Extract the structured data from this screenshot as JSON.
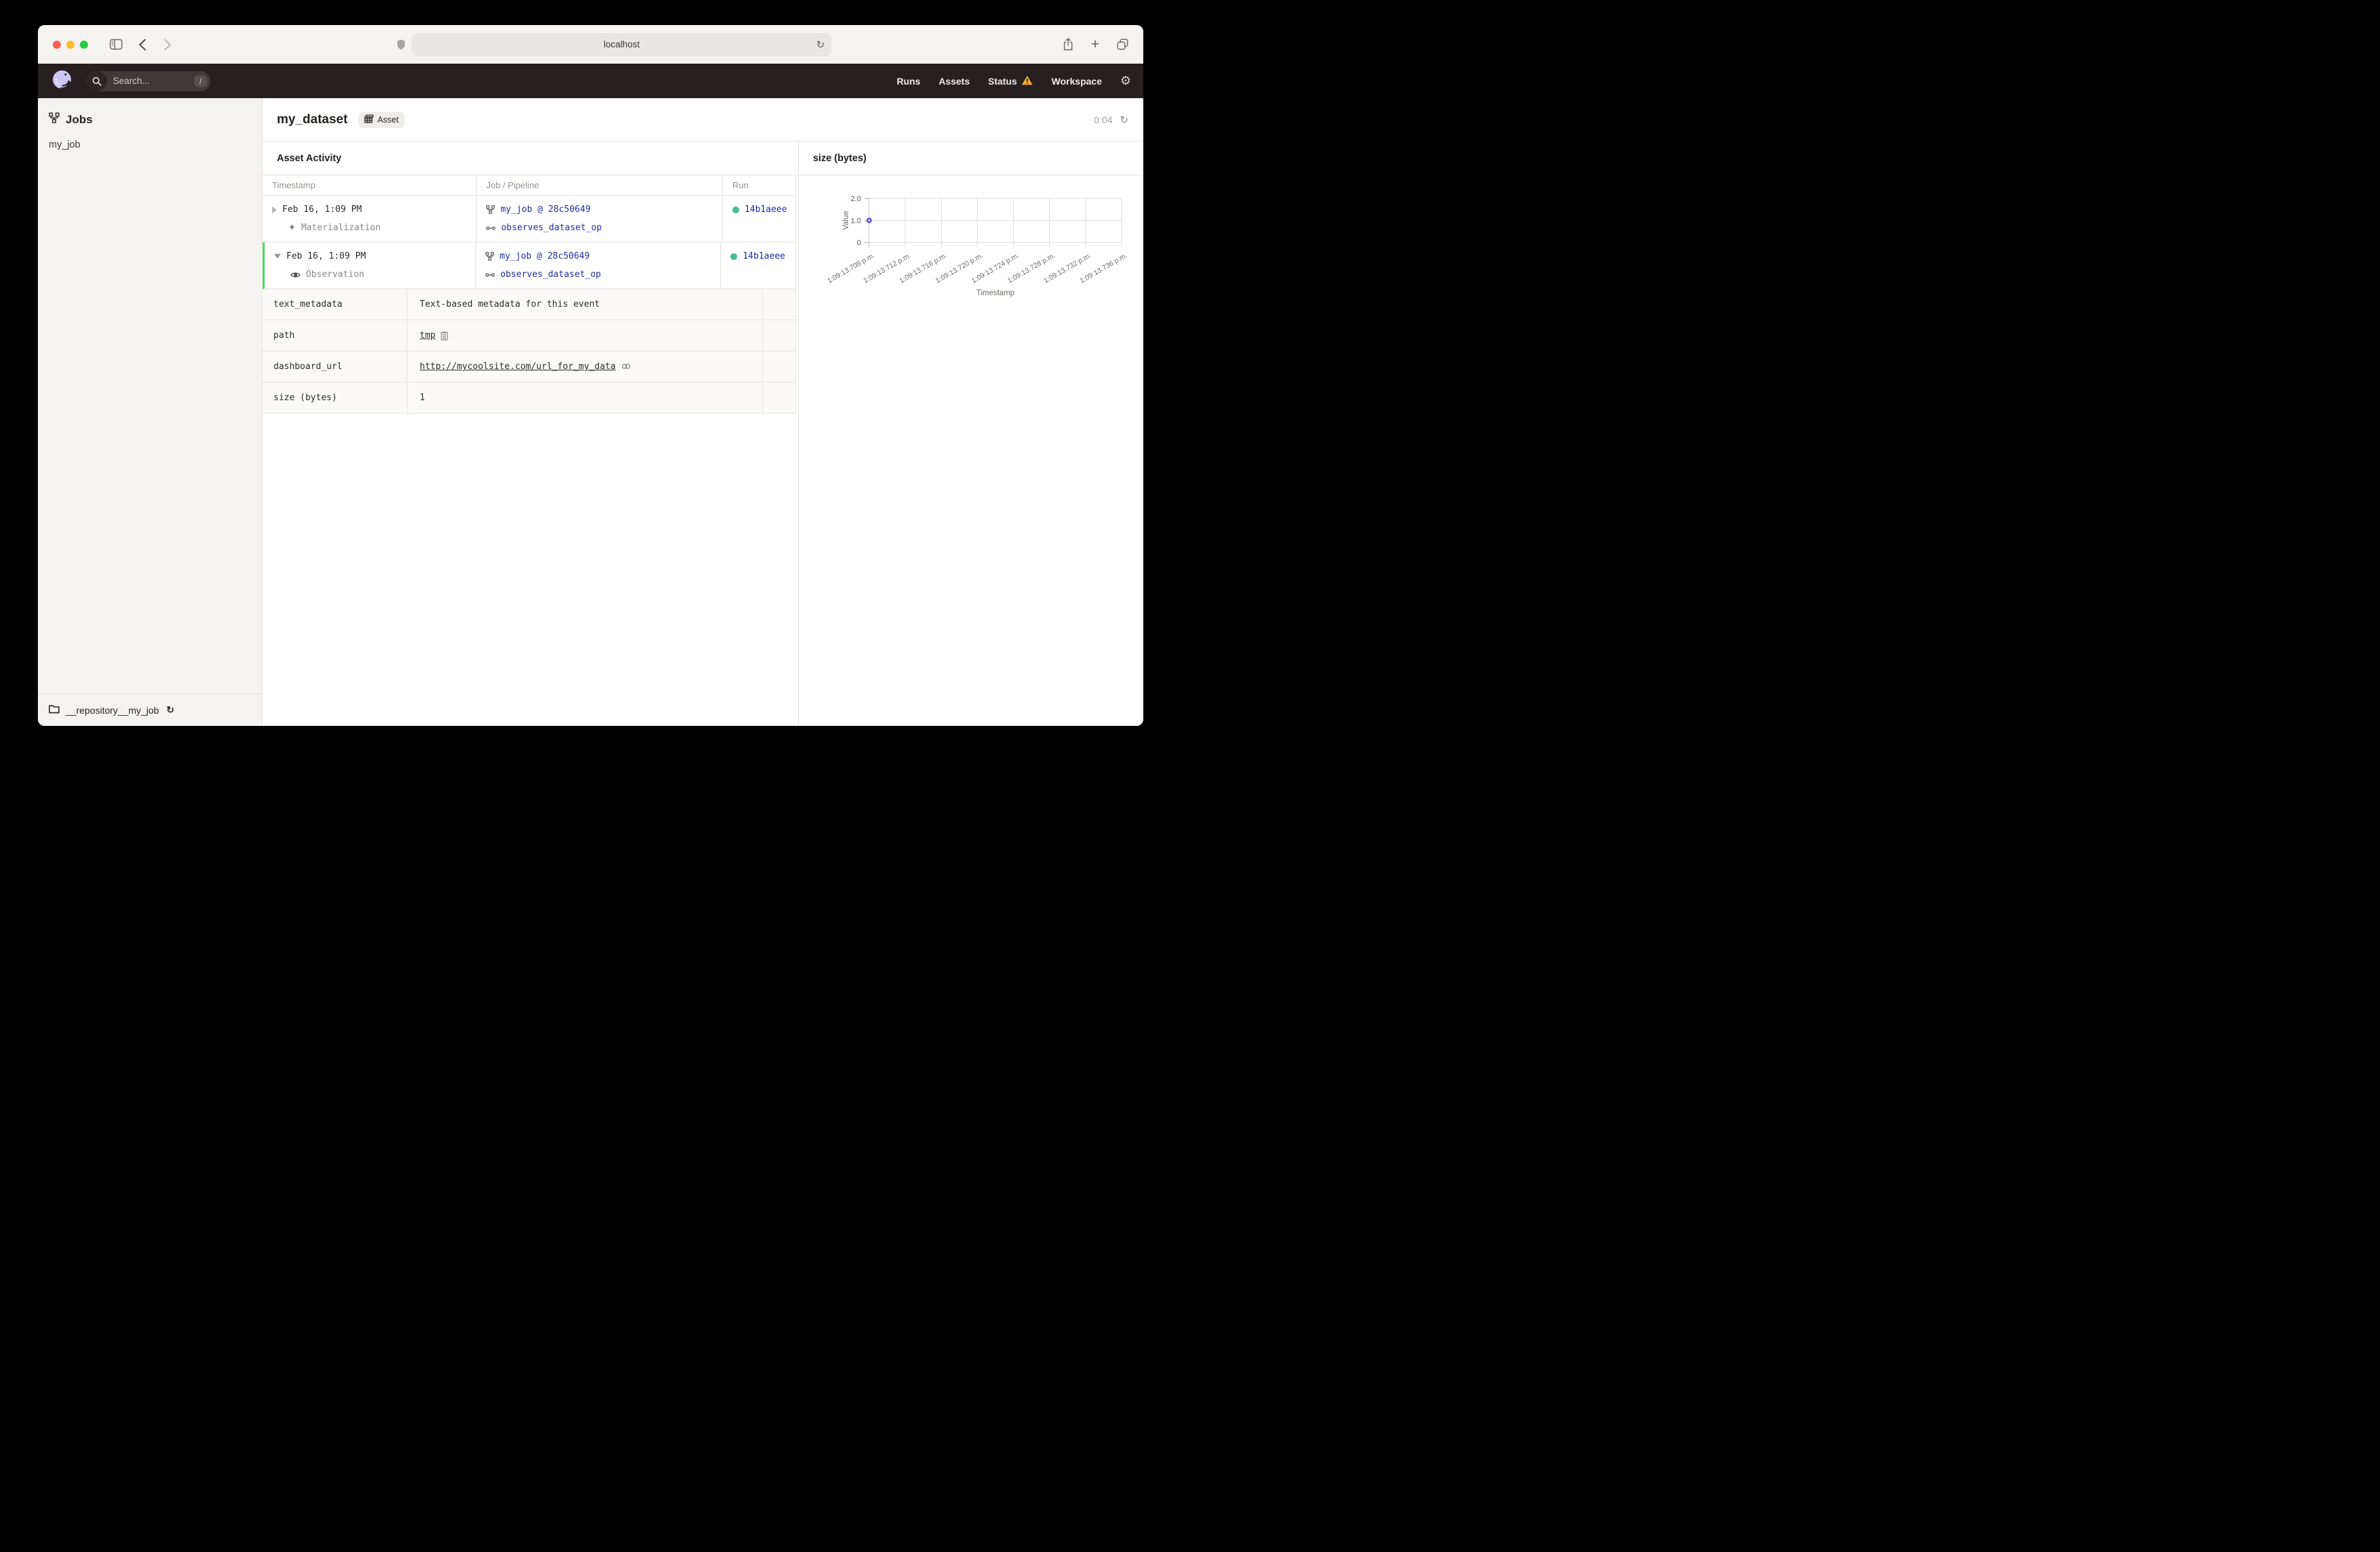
{
  "browser": {
    "url": "localhost",
    "traffic_lights": [
      "#FF5F57",
      "#FEBC2E",
      "#28C840"
    ]
  },
  "topnav": {
    "search_placeholder": "Search...",
    "search_shortcut": "/",
    "links": [
      {
        "label": "Runs"
      },
      {
        "label": "Assets"
      },
      {
        "label": "Status",
        "warning": true
      },
      {
        "label": "Workspace"
      }
    ]
  },
  "sidebar": {
    "header": "Jobs",
    "items": [
      {
        "label": "my_job"
      }
    ],
    "repository": "__repository__my_job"
  },
  "page_header": {
    "title": "my_dataset",
    "tag": "Asset",
    "timer": "0:04"
  },
  "activity": {
    "section_title": "Asset Activity",
    "columns": [
      "Timestamp",
      "Job / Pipeline",
      "Run"
    ],
    "events": [
      {
        "timestamp": "Feb 16, 1:09 PM",
        "type": "Materialization",
        "job": "my_job @ 28c50649",
        "op": "observes_dataset_op",
        "run_id": "14b1aeee",
        "expanded": false
      },
      {
        "timestamp": "Feb 16, 1:09 PM",
        "type": "Observation",
        "job": "my_job @ 28c50649",
        "op": "observes_dataset_op",
        "run_id": "14b1aeee",
        "expanded": true
      }
    ],
    "metadata": [
      {
        "key": "text_metadata",
        "value": "Text-based metadata for this event",
        "kind": "text"
      },
      {
        "key": "path",
        "value": "tmp",
        "kind": "copyable"
      },
      {
        "key": "dashboard_url",
        "value": "http://mycoolsite.com/url_for_my_data",
        "kind": "link"
      },
      {
        "key": "size (bytes)",
        "value": "1",
        "kind": "text"
      }
    ]
  },
  "chart_data": {
    "type": "scatter",
    "title": "size (bytes)",
    "xlabel": "Timestamp",
    "ylabel": "Value",
    "ylim": [
      0,
      2
    ],
    "grid": true,
    "legend_position": "none",
    "y_ticks": [
      {
        "label": "2.0",
        "value": 2
      },
      {
        "label": "1.0",
        "value": 1
      },
      {
        "label": "0",
        "value": 0
      }
    ],
    "x_ticks": [
      "1:09:13.708 p.m.",
      "1:09:13.712 p.m.",
      "1:09:13.716 p.m.",
      "1:09:13.720 p.m.",
      "1:09:13.724 p.m.",
      "1:09:13.728 p.m.",
      "1:09:13.732 p.m.",
      "1:09:13.736 p.m."
    ],
    "points": [
      {
        "x_tick_index": 0,
        "y": 1
      }
    ],
    "point_color": "#5248E3"
  },
  "colors": {
    "link": "#232C9E",
    "run-green": "#40BE8C",
    "row-green": "#4BE062",
    "warning": "#F0A93C",
    "point": "#5248E3"
  }
}
